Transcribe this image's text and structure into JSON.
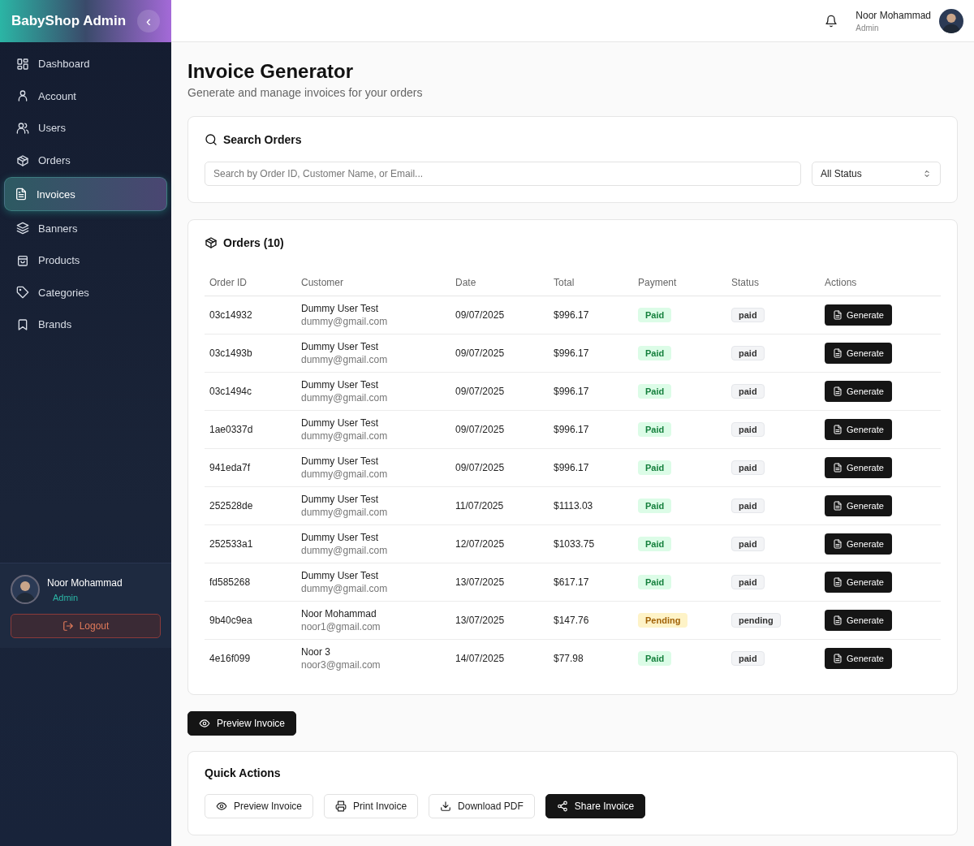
{
  "sidebar": {
    "brand": "BabyShop Admin",
    "collapse": "‹",
    "items": [
      {
        "label": "Dashboard",
        "selected": false
      },
      {
        "label": "Account",
        "selected": false
      },
      {
        "label": "Users",
        "selected": false
      },
      {
        "label": "Orders",
        "selected": false
      },
      {
        "label": "Invoices",
        "selected": true
      },
      {
        "label": "Banners",
        "selected": false
      },
      {
        "label": "Products",
        "selected": false
      },
      {
        "label": "Categories",
        "selected": false
      },
      {
        "label": "Brands",
        "selected": false
      }
    ],
    "user": {
      "name": "Noor Mohammad",
      "role": "Admin"
    },
    "logout": "Logout"
  },
  "header": {
    "user": {
      "name": "Noor Mohammad",
      "role": "Admin"
    }
  },
  "page": {
    "title": "Invoice Generator",
    "subtitle": "Generate and manage invoices for your orders"
  },
  "search": {
    "title": "Search Orders",
    "placeholder": "Search by Order ID, Customer Name, or Email...",
    "status_filter": "All Status"
  },
  "orders": {
    "title": "Orders (10)",
    "columns": [
      "Order ID",
      "Customer",
      "Date",
      "Total",
      "Payment",
      "Status",
      "Actions"
    ],
    "rows": [
      {
        "id": "03c14932",
        "customer": "Dummy User Test",
        "email": "dummy@gmail.com",
        "date": "09/07/2025",
        "total": "$996.17",
        "payment": {
          "text": "Paid",
          "kind": "success"
        },
        "status": "paid",
        "action": "Generate"
      },
      {
        "id": "03c1493b",
        "customer": "Dummy User Test",
        "email": "dummy@gmail.com",
        "date": "09/07/2025",
        "total": "$996.17",
        "payment": {
          "text": "Paid",
          "kind": "success"
        },
        "status": "paid",
        "action": "Generate"
      },
      {
        "id": "03c1494c",
        "customer": "Dummy User Test",
        "email": "dummy@gmail.com",
        "date": "09/07/2025",
        "total": "$996.17",
        "payment": {
          "text": "Paid",
          "kind": "success"
        },
        "status": "paid",
        "action": "Generate"
      },
      {
        "id": "1ae0337d",
        "customer": "Dummy User Test",
        "email": "dummy@gmail.com",
        "date": "09/07/2025",
        "total": "$996.17",
        "payment": {
          "text": "Paid",
          "kind": "success"
        },
        "status": "paid",
        "action": "Generate"
      },
      {
        "id": "941eda7f",
        "customer": "Dummy User Test",
        "email": "dummy@gmail.com",
        "date": "09/07/2025",
        "total": "$996.17",
        "payment": {
          "text": "Paid",
          "kind": "success"
        },
        "status": "paid",
        "action": "Generate"
      },
      {
        "id": "252528de",
        "customer": "Dummy User Test",
        "email": "dummy@gmail.com",
        "date": "11/07/2025",
        "total": "$1113.03",
        "payment": {
          "text": "Paid",
          "kind": "success"
        },
        "status": "paid",
        "action": "Generate"
      },
      {
        "id": "252533a1",
        "customer": "Dummy User Test",
        "email": "dummy@gmail.com",
        "date": "12/07/2025",
        "total": "$1033.75",
        "payment": {
          "text": "Paid",
          "kind": "success"
        },
        "status": "paid",
        "action": "Generate"
      },
      {
        "id": "fd585268",
        "customer": "Dummy User Test",
        "email": "dummy@gmail.com",
        "date": "13/07/2025",
        "total": "$617.17",
        "payment": {
          "text": "Paid",
          "kind": "success"
        },
        "status": "paid",
        "action": "Generate"
      },
      {
        "id": "9b40c9ea",
        "customer": "Noor Mohammad",
        "email": "noor1@gmail.com",
        "date": "13/07/2025",
        "total": "$147.76",
        "payment": {
          "text": "Pending",
          "kind": "warning"
        },
        "status": "pending",
        "action": "Generate"
      },
      {
        "id": "4e16f099",
        "customer": "Noor 3",
        "email": "noor3@gmail.com",
        "date": "14/07/2025",
        "total": "$77.98",
        "payment": {
          "text": "Paid",
          "kind": "success"
        },
        "status": "paid",
        "action": "Generate"
      }
    ]
  },
  "preview_button": "Preview Invoice",
  "quick_actions": {
    "title": "Quick Actions",
    "buttons": [
      {
        "label": "Preview Invoice",
        "kind": "outline"
      },
      {
        "label": "Print Invoice",
        "kind": "outline"
      },
      {
        "label": "Download PDF",
        "kind": "outline"
      },
      {
        "label": "Share Invoice",
        "kind": "solid"
      }
    ]
  }
}
